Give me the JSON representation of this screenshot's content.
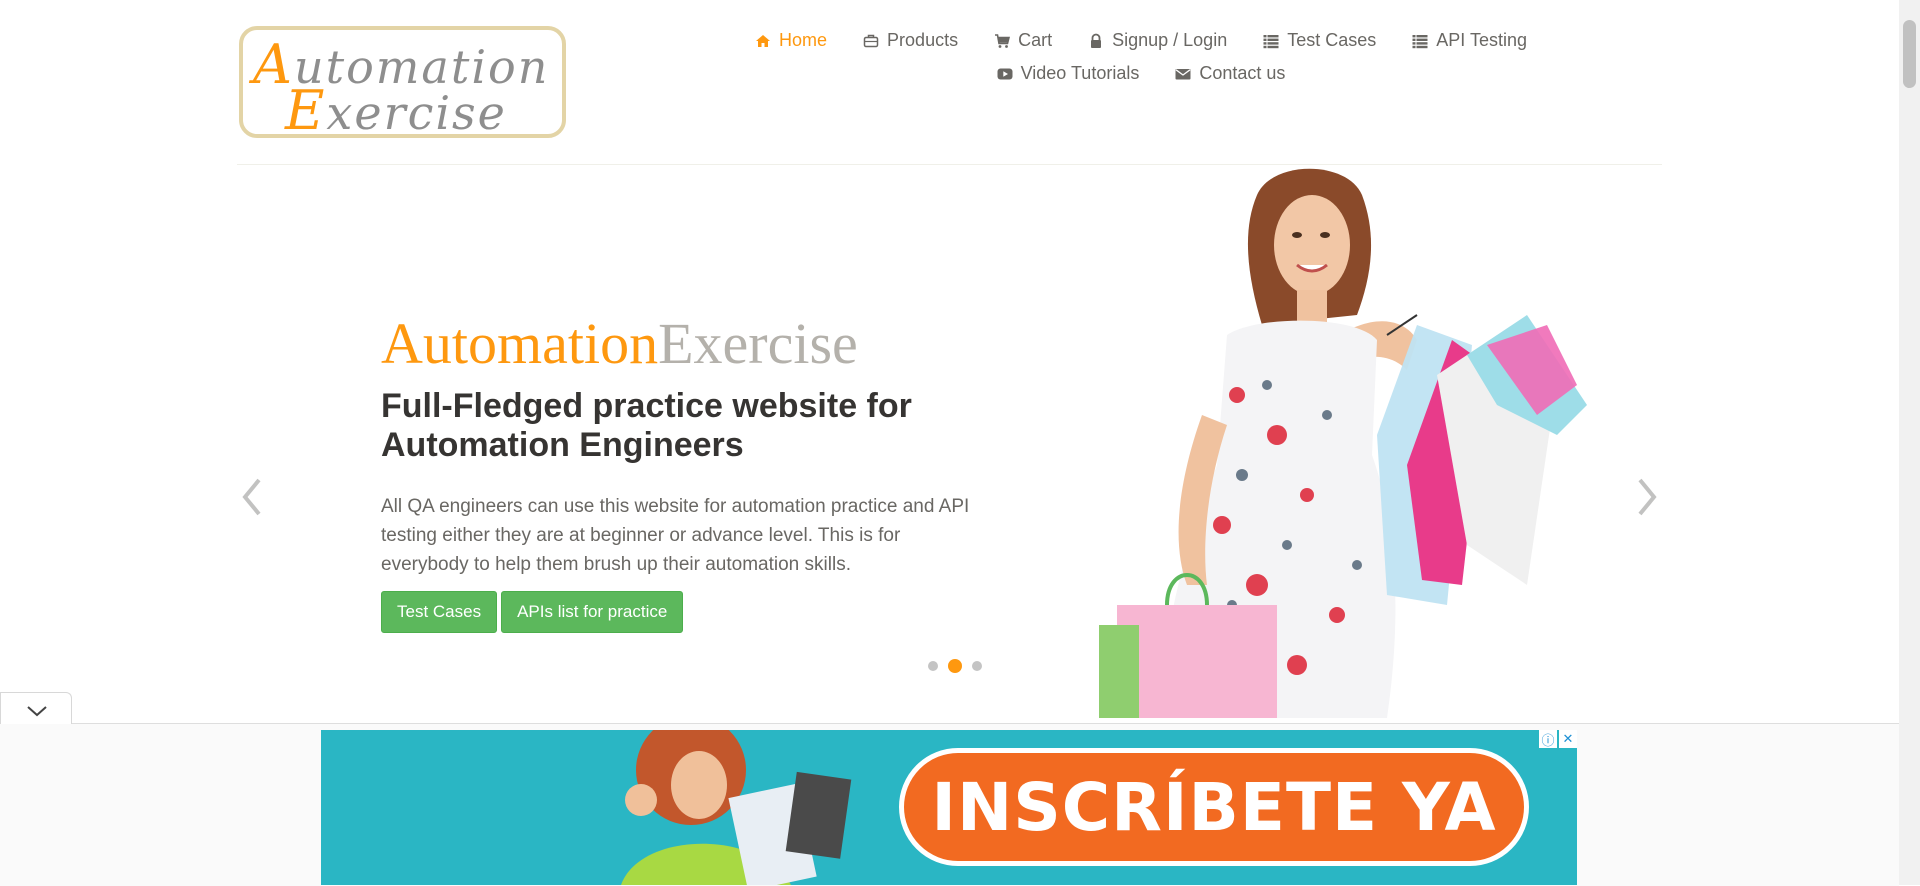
{
  "logo": {
    "line1_cap": "A",
    "line1_rest": "utomation",
    "line2_cap": "E",
    "line2_rest": "xercise"
  },
  "nav": {
    "items": [
      {
        "label": "Home",
        "icon": "home-icon",
        "active": true
      },
      {
        "label": "Products",
        "icon": "briefcase-icon"
      },
      {
        "label": "Cart",
        "icon": "cart-icon"
      },
      {
        "label": "Signup / Login",
        "icon": "lock-icon"
      },
      {
        "label": "Test Cases",
        "icon": "list-icon"
      },
      {
        "label": "API Testing",
        "icon": "list-icon"
      },
      {
        "label": "Video Tutorials",
        "icon": "youtube-play-icon"
      },
      {
        "label": "Contact us",
        "icon": "envelope-icon"
      }
    ]
  },
  "hero": {
    "brand_part1": "Automation",
    "brand_part2": "Exercise",
    "headline": "Full-Fledged practice website for Automation Engineers",
    "description": "All QA engineers can use this website for automation practice and API testing either they are at beginner or advance level. This is for everybody to help them brush up their automation skills.",
    "button_test_cases": "Test Cases",
    "button_apis": "APIs list for practice",
    "slide_count": 3,
    "active_slide": 2
  },
  "ad": {
    "cta": "INSCRÍBETE YA",
    "info_icon": "ⓘ",
    "close_icon": "✕"
  },
  "colors": {
    "accent": "#fe980f",
    "text": "#696763",
    "heading": "#363432",
    "button_green": "#5cb85c",
    "ad_teal": "#2ab6c4",
    "ad_orange": "#f26a21"
  }
}
